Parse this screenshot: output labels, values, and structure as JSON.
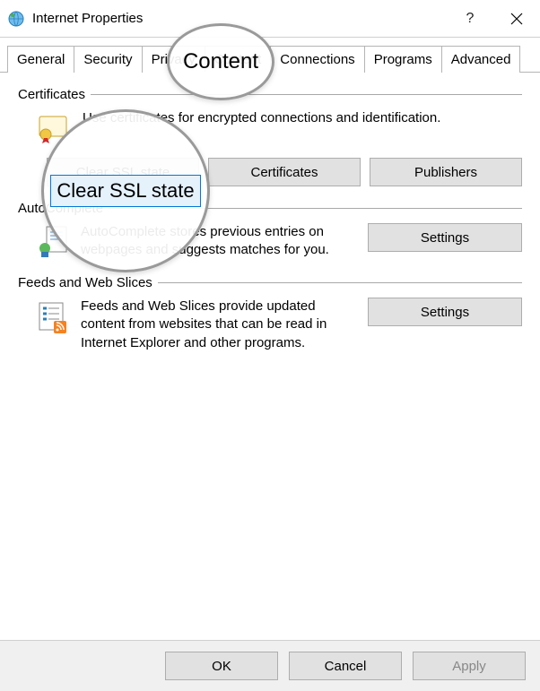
{
  "window": {
    "title": "Internet Properties"
  },
  "tabs": {
    "items": [
      "General",
      "Security",
      "Privacy",
      "Content",
      "Connections",
      "Programs",
      "Advanced"
    ],
    "active_index": 3
  },
  "groups": {
    "certificates": {
      "title": "Certificates",
      "desc": "Use certificates for encrypted connections and identification.",
      "buttons": {
        "clear_ssl": "Clear SSL state",
        "certs": "Certificates",
        "publishers": "Publishers"
      }
    },
    "autocomplete": {
      "title": "AutoComplete",
      "desc": "AutoComplete stores previous entries on webpages and suggests matches for you.",
      "button": "Settings"
    },
    "feeds": {
      "title": "Feeds and Web Slices",
      "desc": "Feeds and Web Slices provide updated content from websites that can be read in Internet Explorer and other programs.",
      "button": "Settings"
    }
  },
  "footer": {
    "ok": "OK",
    "cancel": "Cancel",
    "apply": "Apply"
  },
  "magnifier": {
    "tab_label": "Content",
    "button_label": "Clear SSL state"
  }
}
